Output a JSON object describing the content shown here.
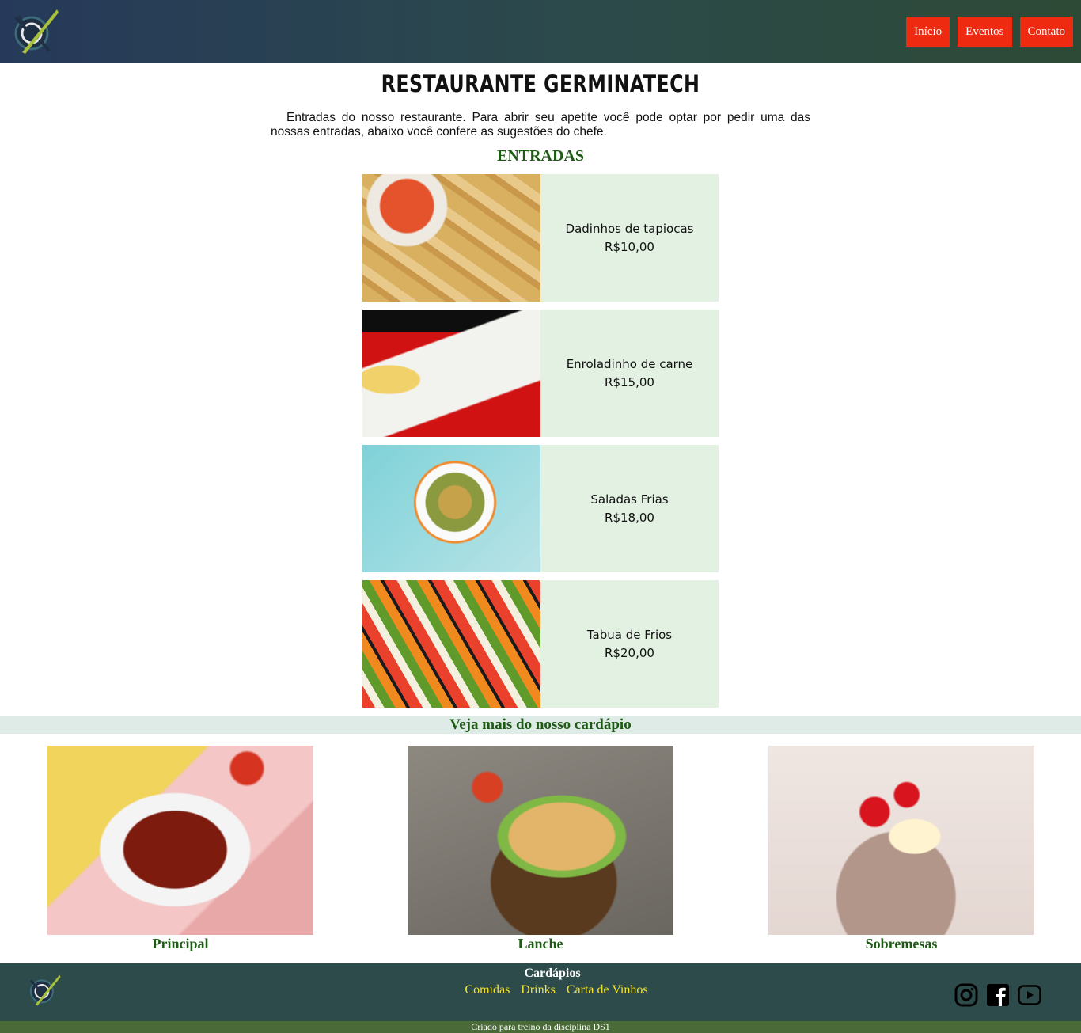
{
  "header": {
    "logo_icon": "fork-knife-logo-icon",
    "nav": [
      {
        "label": "Início"
      },
      {
        "label": "Eventos"
      },
      {
        "label": "Contato"
      }
    ],
    "nav_color": "#ee2a10"
  },
  "main": {
    "title": "RESTAURANTE GERMINATECH",
    "intro": "Entradas do nosso restaurante. Para abrir seu apetite você pode optar por pedir uma das nossas entradas, abaixo você confere as sugestões do chefe.",
    "section_heading": "ENTRADAS",
    "entries": [
      {
        "name": "Dadinhos de tapiocas",
        "price": "R$10,00"
      },
      {
        "name": "Enroladinho de carne",
        "price": "R$15,00"
      },
      {
        "name": "Saladas Frias",
        "price": "R$18,00"
      },
      {
        "name": "Tabua de Frios",
        "price": "R$20,00"
      }
    ]
  },
  "more": {
    "heading": "Veja mais do nosso cardápio",
    "cards": [
      {
        "label": "Principal"
      },
      {
        "label": "Lanche"
      },
      {
        "label": "Sobremesas"
      }
    ]
  },
  "footer": {
    "title": "Cardápios",
    "links": [
      {
        "label": "Comidas"
      },
      {
        "label": "Drinks"
      },
      {
        "label": "Carta de Vinhos"
      }
    ],
    "social_icons": [
      "instagram-icon",
      "facebook-icon",
      "youtube-icon"
    ],
    "credit": "Criado para treino da disciplina DS1"
  },
  "colors": {
    "accent_green": "#1d5a14",
    "entry_bg": "#e3f1e3",
    "footer_bg": "#2e4b4b",
    "link_yellow": "#f2e52c"
  }
}
